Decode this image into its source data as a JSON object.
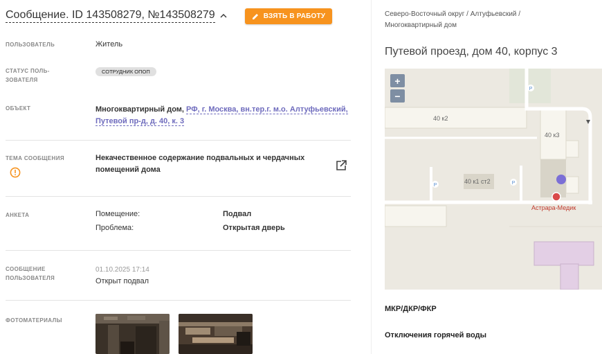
{
  "header": {
    "title": "Сообщение. ID 143508279, №143508279",
    "take_button": "ВЗЯТЬ В РАБОТУ"
  },
  "fields": {
    "user_label": "ПОЛЬЗОВАТЕЛЬ",
    "user_value": "Житель",
    "status_label_1": "СТАТУС ПОЛЬ-",
    "status_label_2": "ЗОВАТЕЛЯ",
    "status_badge": "СОТРУДНИК ОПОП",
    "object_label": "ОБЪЕКТ",
    "object_prefix": "Многоквартирный дом, ",
    "object_link_1": "РФ, г. Москва, вн.тер.г. м.о. Алтуфьевский,",
    "object_link_2": "Путевой пр-д, д. 40, к. 3",
    "topic_label": "ТЕМА СООБЩЕНИЯ",
    "topic_value_1": "Некачественное содержание подвальных и чердачных",
    "topic_value_2": "помещений дома",
    "survey_label": "АНКЕТА",
    "survey": [
      {
        "key": "Помещение:",
        "value": "Подвал"
      },
      {
        "key": "Проблема:",
        "value": "Открытая дверь"
      }
    ],
    "message_label_1": "СООБЩЕНИЕ",
    "message_label_2": "ПОЛЬЗОВАТЕЛЯ",
    "message_date": "01.10.2025 17:14",
    "message_text": "Открыт подвал",
    "photos_label": "ФОТОМАТЕРИАЛЫ"
  },
  "right": {
    "breadcrumb_1": "Северо-Восточный округ / Алтуфьевский /",
    "breadcrumb_2": "Многоквартирный дом",
    "address": "Путевой проезд, дом 40, корпус 3",
    "map": {
      "zoom_in": "+",
      "zoom_out": "−",
      "labels": {
        "b1": "40 к2",
        "b2": "40 к3",
        "b3": "40 к1 ст2",
        "poi": "Астрара-Медик",
        "parking": "P"
      }
    },
    "section1": "МКР/ДКР/ФКР",
    "section2": "Отключения горячей воды"
  },
  "colors": {
    "accent": "#f7931e",
    "link": "#6e6bbd",
    "marker": "#7b6fd6"
  }
}
